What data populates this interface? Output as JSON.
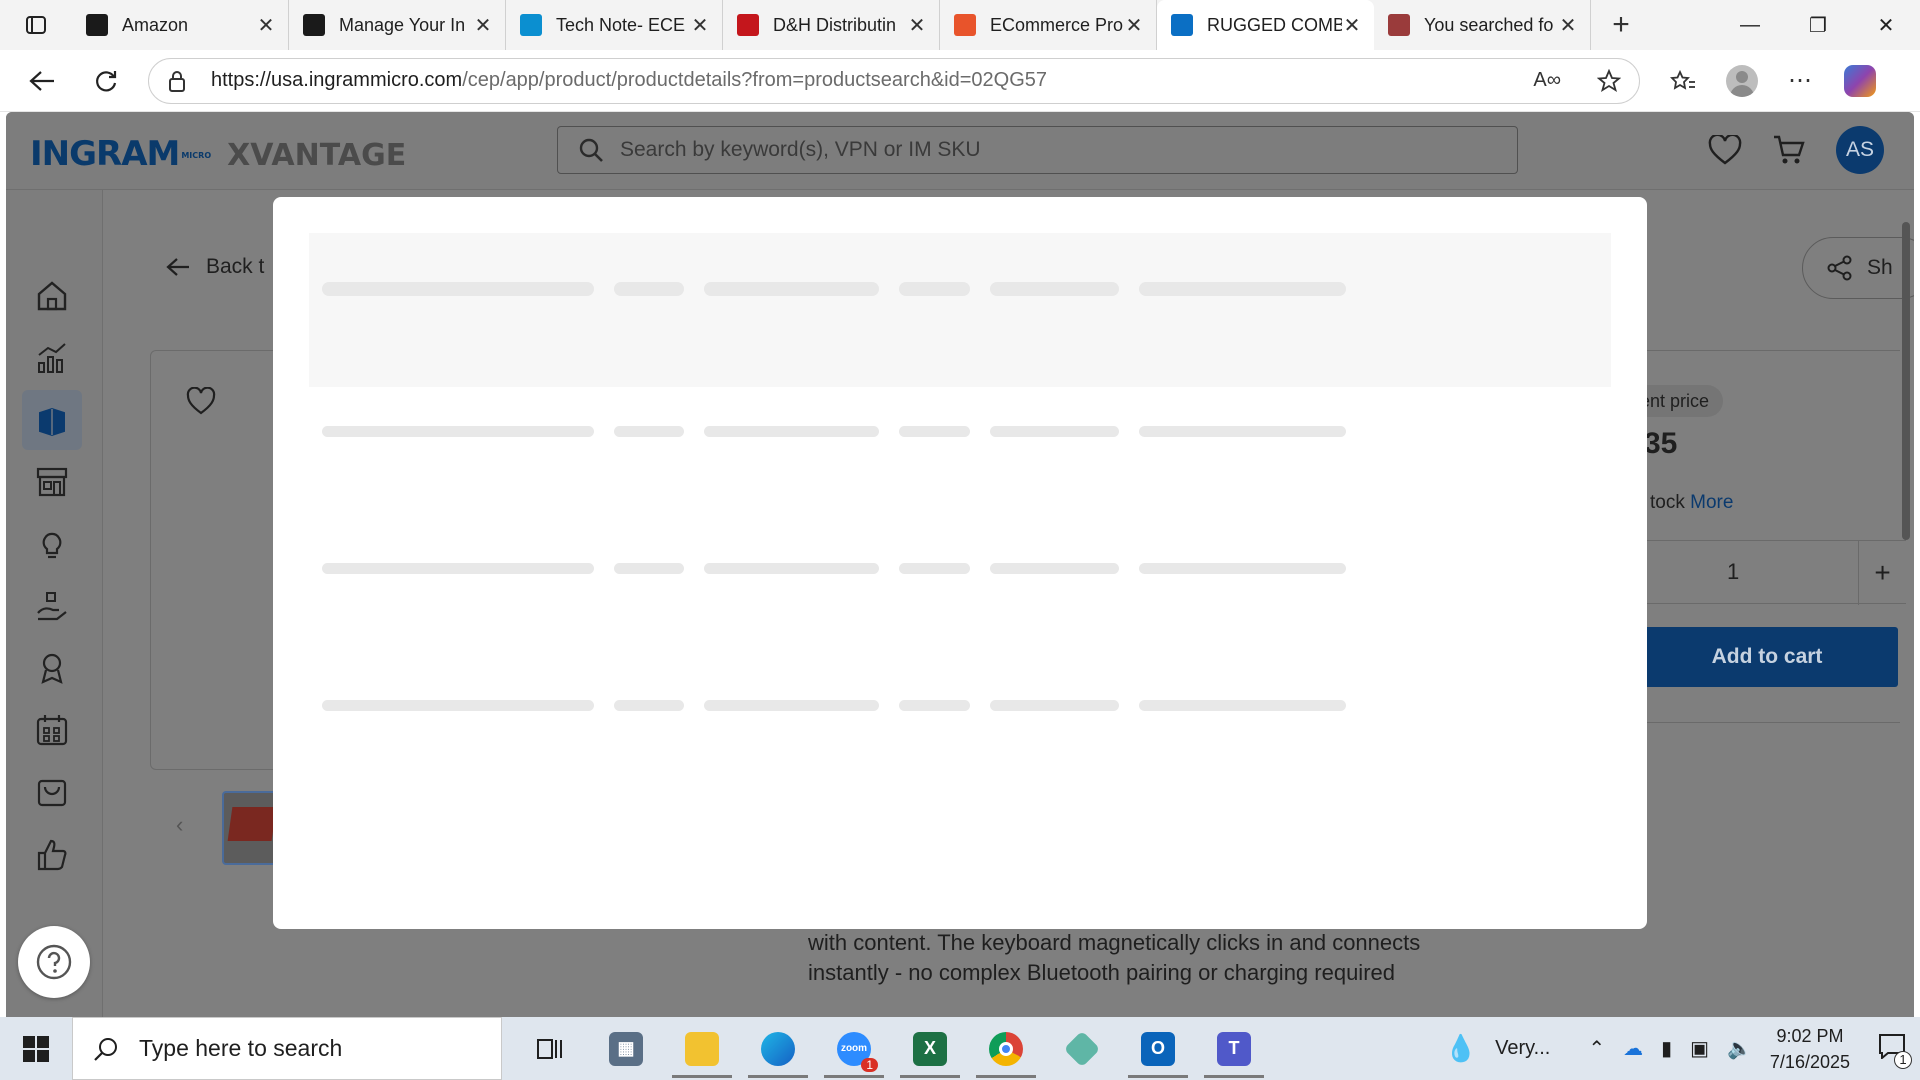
{
  "browser": {
    "tabs": [
      {
        "title": "Amazon",
        "favicon": "amazon-icon",
        "color": "#1a1a1a"
      },
      {
        "title": "Manage Your In",
        "favicon": "amazon-icon",
        "color": "#1a1a1a"
      },
      {
        "title": "Tech Note- ECE",
        "favicon": "ec-icon",
        "color": "#0b8fd0"
      },
      {
        "title": "D&H Distributin",
        "favicon": "dh-icon",
        "color": "#c4161c"
      },
      {
        "title": "ECommerce Pro",
        "favicon": "ecommerce-icon",
        "color": "#e8542b"
      },
      {
        "title": "RUGGED COMB",
        "favicon": "ingram-icon",
        "color": "#0b6fc4",
        "active": true
      },
      {
        "title": "You searched fo",
        "favicon": "search-results-icon",
        "color": "#9a3b3b"
      }
    ],
    "url_host": "https://usa.ingrammicro.com",
    "url_path": "/cep/app/product/productdetails?from=productsearch&id=02QG57"
  },
  "app": {
    "logo_main": "INGRAM",
    "logo_micro": "MICRO",
    "logo_sub": "XVANTAGE",
    "search_placeholder": "Search by keyword(s), VPN or IM SKU",
    "avatar_initials": "AS",
    "back_label": "Back t",
    "share_label": "Sh",
    "price_label": "ent price",
    "price_value": "35",
    "stock_text": "tock",
    "more_label": "More",
    "quantity": "1",
    "add_to_cart_label": "Add to cart",
    "description_lines": [
      "with content. The keyboard magnetically clicks in and connects",
      "instantly - no complex Bluetooth pairing or charging required"
    ],
    "brand_color": "#0b3a6e"
  },
  "taskbar": {
    "search_placeholder": "Type here to search",
    "weather": "Very...",
    "time": "9:02 PM",
    "date": "7/16/2025",
    "notification_count": "1",
    "zoom_badge": "1"
  }
}
